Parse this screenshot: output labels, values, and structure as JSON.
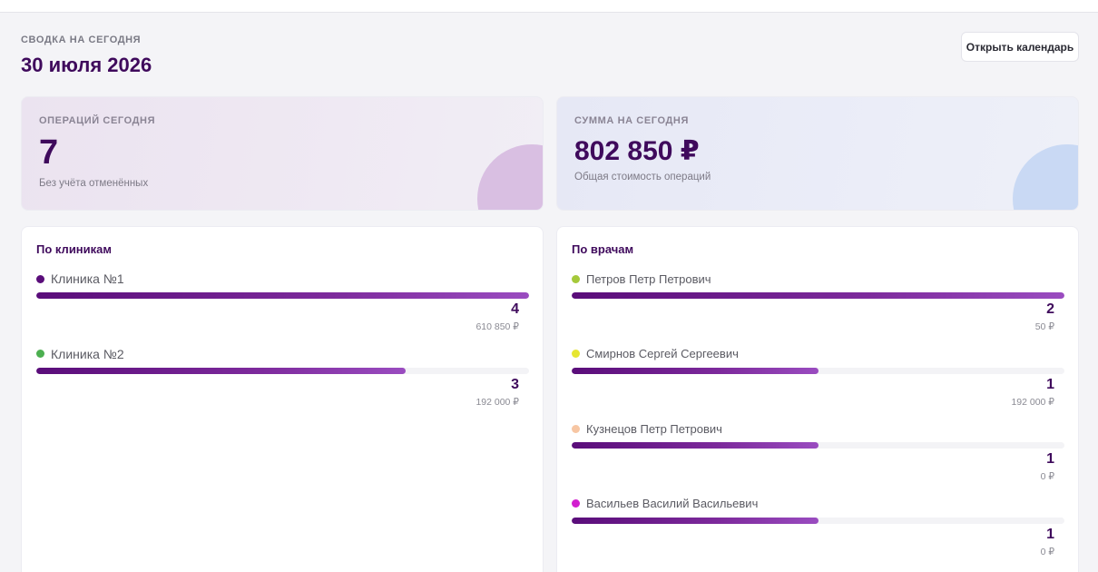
{
  "header": {
    "eyebrow": "СВОДКА НА СЕГОДНЯ",
    "title": "30 июля 2026",
    "calendar_button": "Открыть календарь"
  },
  "stats": {
    "operations": {
      "label": "ОПЕРАЦИЙ СЕГОДНЯ",
      "value": "7",
      "note": "Без учёта отменённых",
      "accent": "#d9bfe2"
    },
    "total": {
      "label": "СУММА НА СЕГОДНЯ",
      "value": "802 850 ₽",
      "note": "Общая стоимость операций",
      "accent": "#c9d9f4"
    }
  },
  "clinics": {
    "title": "По клиникам",
    "items": [
      {
        "name": "Клиника №1",
        "count": "4",
        "sum": "610 850 ₽",
        "share": 1.0,
        "color": "#5a0d7a"
      },
      {
        "name": "Клиника №2",
        "count": "3",
        "sum": "192 000 ₽",
        "share": 0.75,
        "color": "#4caf50"
      }
    ]
  },
  "doctors": {
    "title": "По врачам",
    "items": [
      {
        "name": "Петров Петр Петрович",
        "count": "2",
        "sum": "50 ₽",
        "share": 1.0,
        "color": "#a5c93a"
      },
      {
        "name": "Смирнов Сергей Сергеевич",
        "count": "1",
        "sum": "192 000 ₽",
        "share": 0.5,
        "color": "#e6e632"
      },
      {
        "name": "Кузнецов Петр Петрович",
        "count": "1",
        "sum": "0 ₽",
        "share": 0.5,
        "color": "#f7c6a3"
      },
      {
        "name": "Васильев Василий Васильевич",
        "count": "1",
        "sum": "0 ₽",
        "share": 0.5,
        "color": "#d21fcf"
      }
    ]
  }
}
